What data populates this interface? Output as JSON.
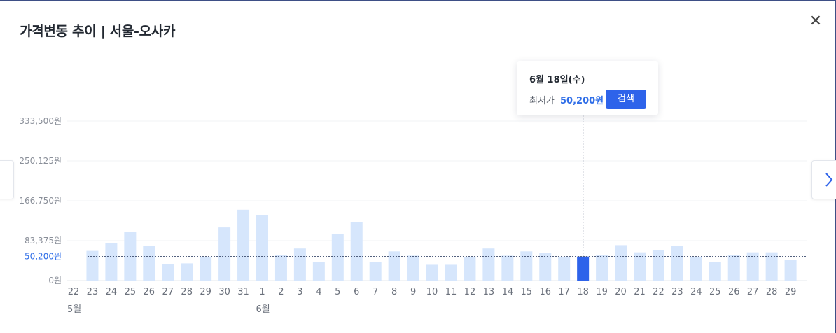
{
  "title": "가격변동 추이 | 서울-오사카",
  "close_icon": "close-icon",
  "nav": {
    "prev_icon": "chevron-left-icon",
    "next_icon": "chevron-right-icon"
  },
  "tooltip": {
    "date": "6월 18일(수)",
    "label": "최저가",
    "value": "50,200원",
    "button": "검색"
  },
  "colors": {
    "bar": "#d6e6fc",
    "highlight": "#2e63ea",
    "accent": "#2f6ee8"
  },
  "chart_data": {
    "type": "bar",
    "title": "가격변동 추이 | 서울-오사카",
    "ylim": [
      0,
      333500
    ],
    "yticks": [
      {
        "value": 0,
        "label": "0원"
      },
      {
        "value": 83375,
        "label": "83,375원"
      },
      {
        "value": 166750,
        "label": "166,750원"
      },
      {
        "value": 250125,
        "label": "250,125원"
      },
      {
        "value": 333500,
        "label": "333,500원"
      }
    ],
    "reference_line": {
      "value": 50200,
      "label": "50,200원"
    },
    "categories": [
      "22",
      "23",
      "24",
      "25",
      "26",
      "27",
      "28",
      "29",
      "30",
      "31",
      "1",
      "2",
      "3",
      "4",
      "5",
      "6",
      "7",
      "8",
      "9",
      "10",
      "11",
      "12",
      "13",
      "14",
      "15",
      "16",
      "17",
      "18",
      "19",
      "20",
      "21",
      "22",
      "23",
      "24",
      "25",
      "26",
      "27",
      "28",
      "29"
    ],
    "values": [
      null,
      62000,
      79000,
      101000,
      73000,
      35000,
      36000,
      49000,
      111000,
      148000,
      137000,
      53000,
      67000,
      39000,
      98000,
      122000,
      39000,
      61000,
      52000,
      33000,
      33000,
      49000,
      67000,
      52000,
      61000,
      57000,
      49000,
      50200,
      54000,
      74000,
      59000,
      64000,
      73000,
      49000,
      39000,
      53000,
      59000,
      59000,
      43000
    ],
    "highlight": "18",
    "month_labels": [
      {
        "at": "22",
        "label": "5월"
      },
      {
        "at": "1",
        "label": "6월"
      }
    ],
    "grid": true
  }
}
